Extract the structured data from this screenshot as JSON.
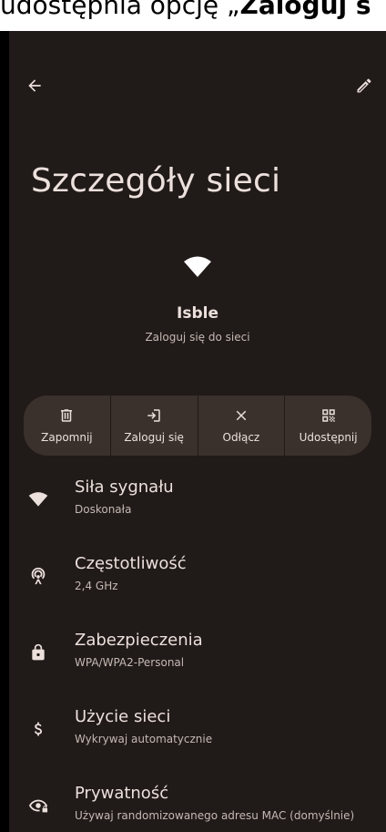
{
  "caption": {
    "before": "udostępnia opcję „",
    "bold": "Zaloguj s"
  },
  "header": {
    "back_icon": "arrow-back-icon",
    "edit_icon": "pencil-icon",
    "title": "Szczegóły sieci"
  },
  "network": {
    "icon": "wifi-icon",
    "name": "Isble",
    "status": "Zaloguj się do sieci"
  },
  "actions": [
    {
      "icon": "trash-icon",
      "label": "Zapomnij"
    },
    {
      "icon": "login-icon",
      "label": "Zaloguj się"
    },
    {
      "icon": "close-icon",
      "label": "Odłącz"
    },
    {
      "icon": "qr-code-icon",
      "label": "Udostępnij"
    }
  ],
  "details": [
    {
      "icon": "wifi-icon",
      "title": "Siła sygnału",
      "subtitle": "Doskonała"
    },
    {
      "icon": "antenna-icon",
      "title": "Częstotliwość",
      "subtitle": "2,4 GHz"
    },
    {
      "icon": "lock-icon",
      "title": "Zabezpieczenia",
      "subtitle": "WPA/WPA2-Personal"
    },
    {
      "icon": "dollar-icon",
      "title": "Użycie sieci",
      "subtitle": "Wykrywaj automatycznie"
    },
    {
      "icon": "privacy-eye-icon",
      "title": "Prywatność",
      "subtitle": "Używaj randomizowanego adresu MAC (domyślnie)"
    }
  ],
  "colors": {
    "background": "#201a18",
    "surface": "#3a302c",
    "text_primary": "#ece0dc",
    "text_secondary": "#c5b9b4"
  }
}
